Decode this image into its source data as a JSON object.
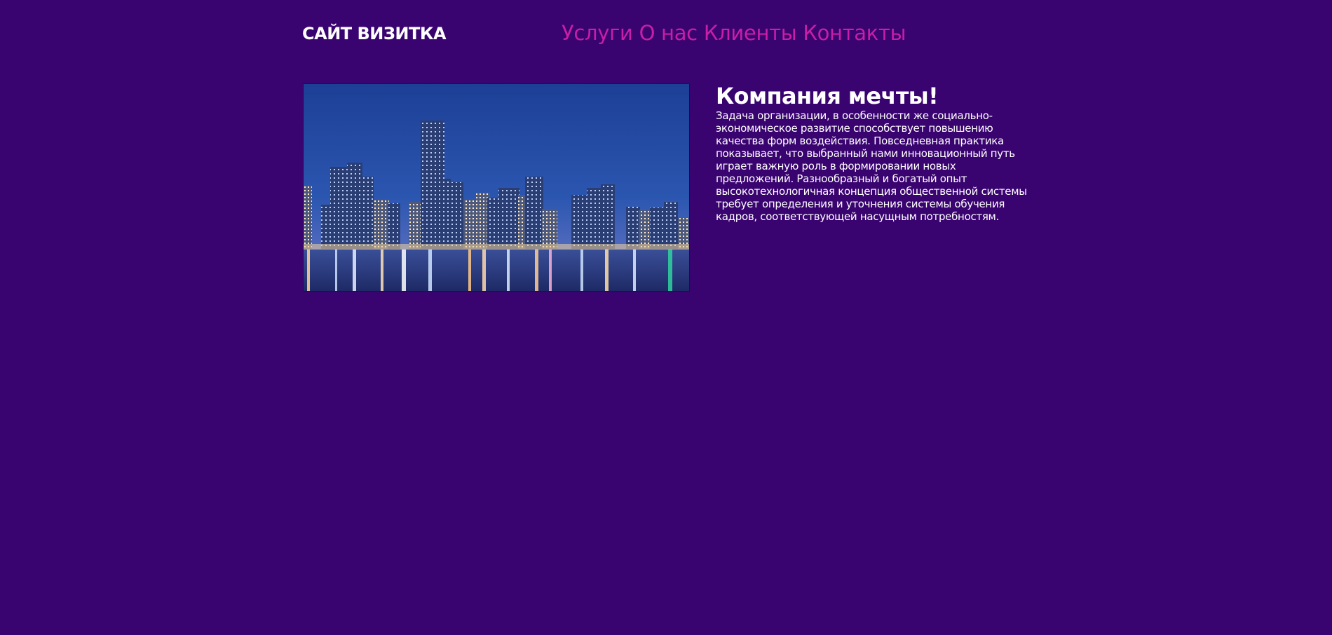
{
  "header": {
    "logo": "САЙТ ВИЗИТКА",
    "nav": [
      {
        "label": "Услуги"
      },
      {
        "label": "О нас"
      },
      {
        "label": "Клиенты"
      },
      {
        "label": "Контакты"
      }
    ]
  },
  "main": {
    "image_alt_icon": "city-skyline-photo",
    "title": "Компания мечты!",
    "body": "Задача организации, в особенности же социально-экономическое развитие способствует повышению качества форм воздействия. Повседневная практика показывает, что выбранный нами инновационный путь играет важную роль в формировании новых предложений. Разнообразный и богатый опыт высокотехнологичная концепция общественной системы требует определения и уточнения системы обучения кадров, соответствующей насущным потребностям."
  },
  "colors": {
    "background": "#3a0470",
    "nav_link": "#c81ea8",
    "text": "#ffffff"
  }
}
